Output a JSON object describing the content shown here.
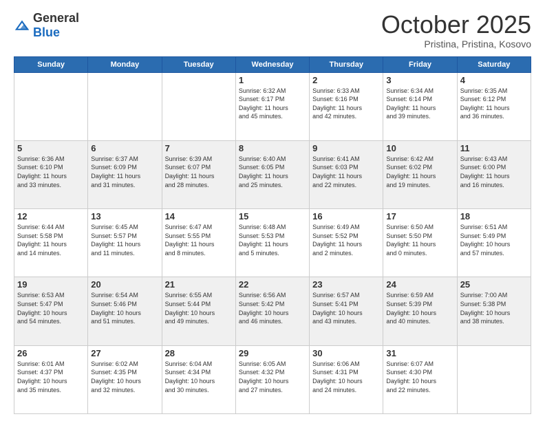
{
  "logo": {
    "text_general": "General",
    "text_blue": "Blue"
  },
  "header": {
    "month_title": "October 2025",
    "location": "Pristina, Pristina, Kosovo"
  },
  "weekdays": [
    "Sunday",
    "Monday",
    "Tuesday",
    "Wednesday",
    "Thursday",
    "Friday",
    "Saturday"
  ],
  "weeks": [
    [
      {
        "day": "",
        "info": ""
      },
      {
        "day": "",
        "info": ""
      },
      {
        "day": "",
        "info": ""
      },
      {
        "day": "1",
        "info": "Sunrise: 6:32 AM\nSunset: 6:17 PM\nDaylight: 11 hours\nand 45 minutes."
      },
      {
        "day": "2",
        "info": "Sunrise: 6:33 AM\nSunset: 6:16 PM\nDaylight: 11 hours\nand 42 minutes."
      },
      {
        "day": "3",
        "info": "Sunrise: 6:34 AM\nSunset: 6:14 PM\nDaylight: 11 hours\nand 39 minutes."
      },
      {
        "day": "4",
        "info": "Sunrise: 6:35 AM\nSunset: 6:12 PM\nDaylight: 11 hours\nand 36 minutes."
      }
    ],
    [
      {
        "day": "5",
        "info": "Sunrise: 6:36 AM\nSunset: 6:10 PM\nDaylight: 11 hours\nand 33 minutes."
      },
      {
        "day": "6",
        "info": "Sunrise: 6:37 AM\nSunset: 6:09 PM\nDaylight: 11 hours\nand 31 minutes."
      },
      {
        "day": "7",
        "info": "Sunrise: 6:39 AM\nSunset: 6:07 PM\nDaylight: 11 hours\nand 28 minutes."
      },
      {
        "day": "8",
        "info": "Sunrise: 6:40 AM\nSunset: 6:05 PM\nDaylight: 11 hours\nand 25 minutes."
      },
      {
        "day": "9",
        "info": "Sunrise: 6:41 AM\nSunset: 6:03 PM\nDaylight: 11 hours\nand 22 minutes."
      },
      {
        "day": "10",
        "info": "Sunrise: 6:42 AM\nSunset: 6:02 PM\nDaylight: 11 hours\nand 19 minutes."
      },
      {
        "day": "11",
        "info": "Sunrise: 6:43 AM\nSunset: 6:00 PM\nDaylight: 11 hours\nand 16 minutes."
      }
    ],
    [
      {
        "day": "12",
        "info": "Sunrise: 6:44 AM\nSunset: 5:58 PM\nDaylight: 11 hours\nand 14 minutes."
      },
      {
        "day": "13",
        "info": "Sunrise: 6:45 AM\nSunset: 5:57 PM\nDaylight: 11 hours\nand 11 minutes."
      },
      {
        "day": "14",
        "info": "Sunrise: 6:47 AM\nSunset: 5:55 PM\nDaylight: 11 hours\nand 8 minutes."
      },
      {
        "day": "15",
        "info": "Sunrise: 6:48 AM\nSunset: 5:53 PM\nDaylight: 11 hours\nand 5 minutes."
      },
      {
        "day": "16",
        "info": "Sunrise: 6:49 AM\nSunset: 5:52 PM\nDaylight: 11 hours\nand 2 minutes."
      },
      {
        "day": "17",
        "info": "Sunrise: 6:50 AM\nSunset: 5:50 PM\nDaylight: 11 hours\nand 0 minutes."
      },
      {
        "day": "18",
        "info": "Sunrise: 6:51 AM\nSunset: 5:49 PM\nDaylight: 10 hours\nand 57 minutes."
      }
    ],
    [
      {
        "day": "19",
        "info": "Sunrise: 6:53 AM\nSunset: 5:47 PM\nDaylight: 10 hours\nand 54 minutes."
      },
      {
        "day": "20",
        "info": "Sunrise: 6:54 AM\nSunset: 5:46 PM\nDaylight: 10 hours\nand 51 minutes."
      },
      {
        "day": "21",
        "info": "Sunrise: 6:55 AM\nSunset: 5:44 PM\nDaylight: 10 hours\nand 49 minutes."
      },
      {
        "day": "22",
        "info": "Sunrise: 6:56 AM\nSunset: 5:42 PM\nDaylight: 10 hours\nand 46 minutes."
      },
      {
        "day": "23",
        "info": "Sunrise: 6:57 AM\nSunset: 5:41 PM\nDaylight: 10 hours\nand 43 minutes."
      },
      {
        "day": "24",
        "info": "Sunrise: 6:59 AM\nSunset: 5:39 PM\nDaylight: 10 hours\nand 40 minutes."
      },
      {
        "day": "25",
        "info": "Sunrise: 7:00 AM\nSunset: 5:38 PM\nDaylight: 10 hours\nand 38 minutes."
      }
    ],
    [
      {
        "day": "26",
        "info": "Sunrise: 6:01 AM\nSunset: 4:37 PM\nDaylight: 10 hours\nand 35 minutes."
      },
      {
        "day": "27",
        "info": "Sunrise: 6:02 AM\nSunset: 4:35 PM\nDaylight: 10 hours\nand 32 minutes."
      },
      {
        "day": "28",
        "info": "Sunrise: 6:04 AM\nSunset: 4:34 PM\nDaylight: 10 hours\nand 30 minutes."
      },
      {
        "day": "29",
        "info": "Sunrise: 6:05 AM\nSunset: 4:32 PM\nDaylight: 10 hours\nand 27 minutes."
      },
      {
        "day": "30",
        "info": "Sunrise: 6:06 AM\nSunset: 4:31 PM\nDaylight: 10 hours\nand 24 minutes."
      },
      {
        "day": "31",
        "info": "Sunrise: 6:07 AM\nSunset: 4:30 PM\nDaylight: 10 hours\nand 22 minutes."
      },
      {
        "day": "",
        "info": ""
      }
    ]
  ]
}
